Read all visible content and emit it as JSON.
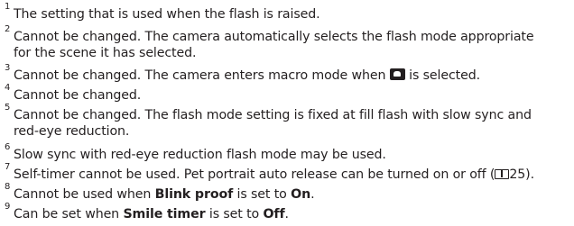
{
  "notes": [
    {
      "num": "1",
      "lines": [
        "The setting that is used when the flash is raised."
      ]
    },
    {
      "num": "2",
      "lines": [
        "Cannot be changed. The camera automatically selects the flash mode appropriate",
        "for the scene it has selected."
      ]
    },
    {
      "num": "3",
      "before_icon": "Cannot be changed. The camera enters macro mode when ",
      "icon": "scene-icon",
      "after_icon": " is selected."
    },
    {
      "num": "4",
      "lines": [
        "Cannot be changed."
      ]
    },
    {
      "num": "5",
      "lines": [
        "Cannot be changed. The flash mode setting is fixed at fill flash with slow sync and",
        "red-eye reduction."
      ]
    },
    {
      "num": "6",
      "lines": [
        "Slow sync with red-eye reduction flash mode may be used."
      ]
    },
    {
      "num": "7",
      "before_icon": "Self-timer cannot be used. Pet portrait auto release can be turned on or off (",
      "icon": "book-icon",
      "after_icon": "25)."
    },
    {
      "num": "8",
      "before": "Cannot be used when ",
      "bold1": "Blink proof",
      "middle": " is set to ",
      "bold2": "On",
      "after": "."
    },
    {
      "num": "9",
      "before": "Can be set when ",
      "bold1": "Smile timer",
      "middle": " is set to ",
      "bold2": "Off",
      "after": "."
    }
  ]
}
